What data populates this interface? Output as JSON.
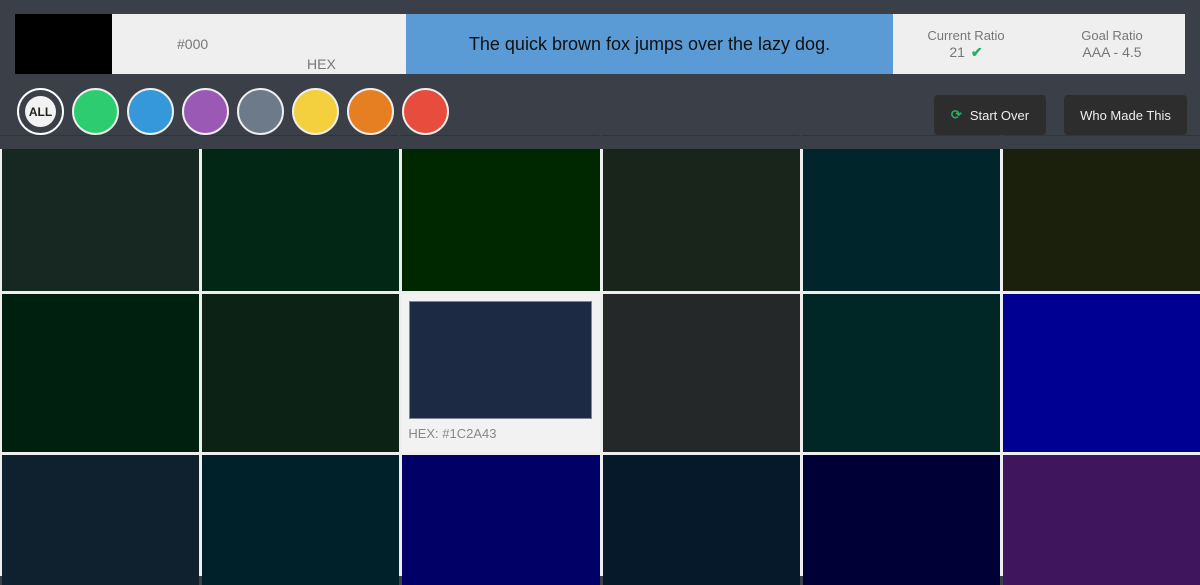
{
  "header": {
    "preview_color": "#000000",
    "hex_value": "#000",
    "hex_label": "HEX",
    "sample_text": "The quick brown fox jumps over the lazy dog.",
    "sample_bg": "#5b9bd5",
    "current_ratio_label": "Current Ratio",
    "current_ratio_value": "21",
    "current_ratio_status": "pass",
    "goal_ratio_label": "Goal Ratio",
    "goal_ratio_value": "AAA - 4.5"
  },
  "filters": [
    {
      "name": "all",
      "label": "ALL",
      "color": null,
      "active": true
    },
    {
      "name": "green",
      "color": "#2ecc71"
    },
    {
      "name": "blue",
      "color": "#3498db"
    },
    {
      "name": "purple",
      "color": "#9b59b6"
    },
    {
      "name": "gray",
      "color": "#6c7a89"
    },
    {
      "name": "yellow",
      "color": "#f4d03f"
    },
    {
      "name": "orange",
      "color": "#e67e22"
    },
    {
      "name": "red",
      "color": "#e74c3c"
    }
  ],
  "buttons": {
    "start_over": "Start Over",
    "who_made_this": "Who Made This"
  },
  "tiles": [
    {
      "color": "#172822"
    },
    {
      "color": "#022714"
    },
    {
      "color": "#002800"
    },
    {
      "color": "#19241a"
    },
    {
      "color": "#00252a"
    },
    {
      "color": "#1a200b"
    },
    {
      "color": "#00200f"
    },
    {
      "color": "#0b2215"
    },
    {
      "color": "#1c2a43",
      "selected": true,
      "caption": "HEX: #1C2A43"
    },
    {
      "color": "#242829"
    },
    {
      "color": "#002626"
    },
    {
      "color": "#000092"
    },
    {
      "color": "#0f202f"
    },
    {
      "color": "#00212a"
    },
    {
      "color": "#000066"
    },
    {
      "color": "#06192b"
    },
    {
      "color": "#000036"
    },
    {
      "color": "#3f165e"
    }
  ]
}
